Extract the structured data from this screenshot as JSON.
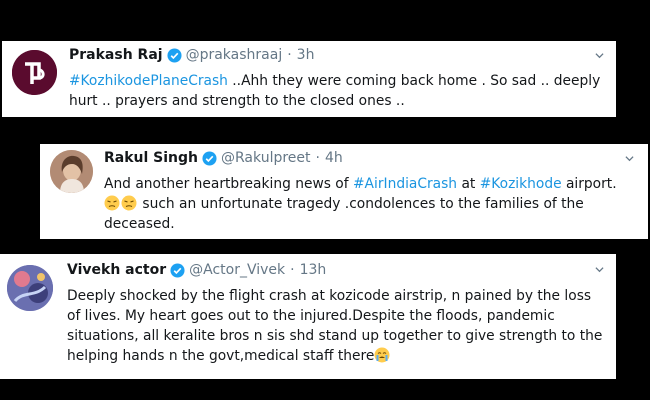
{
  "tweets": [
    {
      "name": "Prakash Raj",
      "handle": "@prakashraaj",
      "dot": "·",
      "time": "3h",
      "lines": [
        {
          "hashtag": "#KozhikodePlaneCrash",
          "text": " ..Ahh they were coming back home . So sad .. deeply"
        },
        {
          "text": "hurt .. prayers and strength to the closed ones .."
        }
      ]
    },
    {
      "name": "Rakul Singh",
      "handle": "@Rakulpreet",
      "dot": "·",
      "time": "4h",
      "lines": [
        {
          "pre": "And another heartbreaking news of ",
          "hashtag1": "#AirIndiaCrash",
          "mid": " at ",
          "hashtag2": "#Kozikhode",
          "post": " airport."
        },
        {
          "text": " such an unfortunate tragedy .condolences to the families of the"
        },
        {
          "text": "deceased."
        }
      ]
    },
    {
      "name": "Vivekh actor",
      "handle": "@Actor_Vivek",
      "dot": "·",
      "time": "13h",
      "lines": [
        {
          "text": "Deeply shocked by the flight crash at kozicode airstrip, n pained by the loss"
        },
        {
          "text": "of lives. My heart goes out to the injured.Despite the floods, pandemic"
        },
        {
          "text": "situations, all keralite bros n sis shd stand up together to give strength to the"
        },
        {
          "text": "helping hands n the govt,medical staff there"
        }
      ]
    }
  ],
  "icons": {
    "verified": "verified-badge-icon",
    "chevron": "chevron-down-icon",
    "emoji_sad": "pensive-face-emoji",
    "emoji_cry": "crying-face-emoji"
  },
  "colors": {
    "hashtag": "#1b95e0",
    "verified": "#1da1f2",
    "secondary": "#657786",
    "background": "#000000"
  }
}
